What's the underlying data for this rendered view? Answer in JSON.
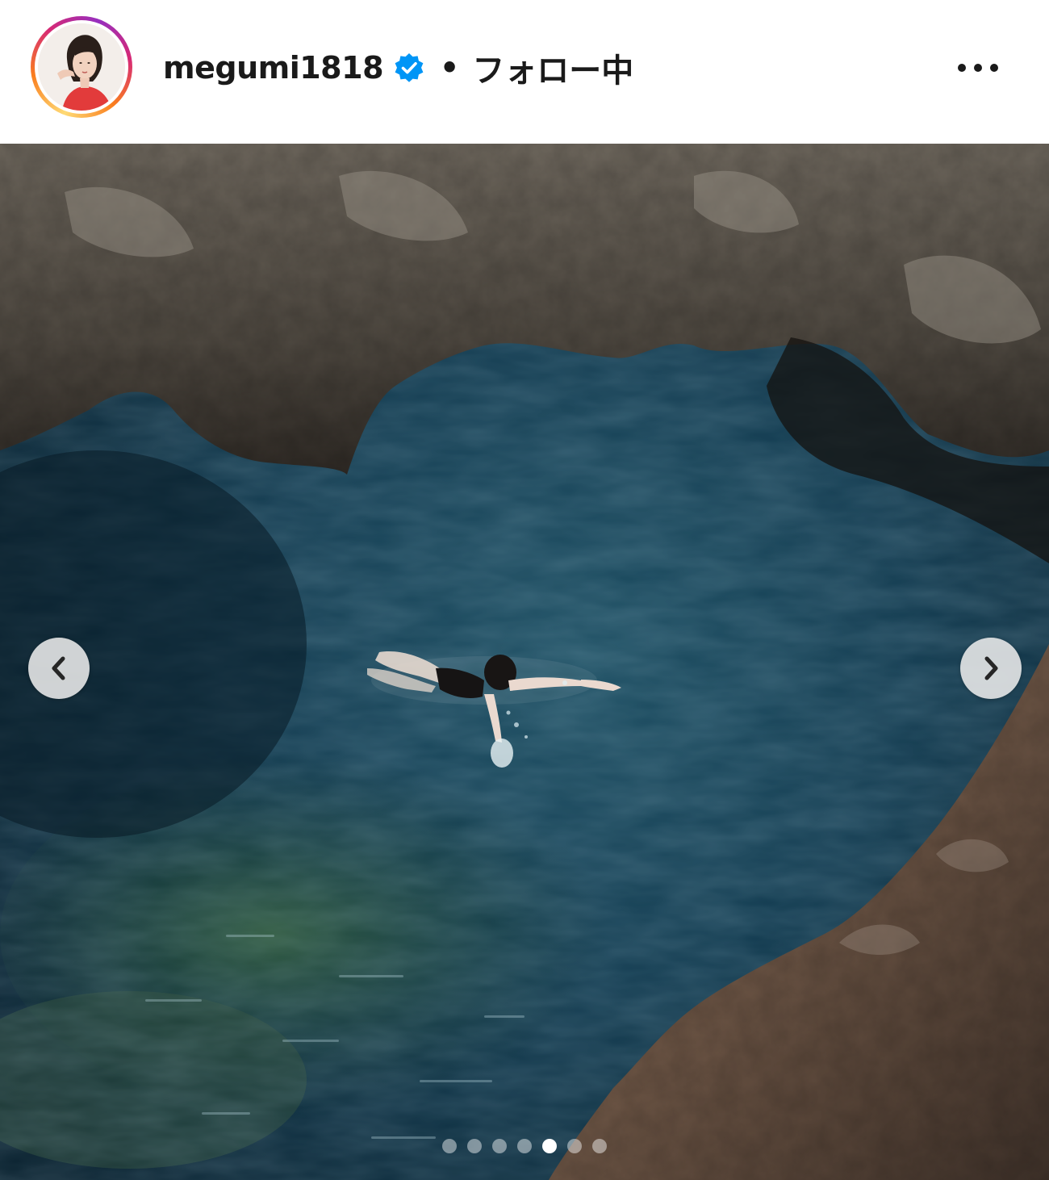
{
  "post": {
    "username": "megumi1818",
    "verified": true,
    "separator": "•",
    "follow_status": "フォロー中",
    "more_icon": "more-options-icon"
  },
  "carousel": {
    "total_slides": 7,
    "active_index": 4,
    "prev_icon": "chevron-left-icon",
    "next_icon": "chevron-right-icon"
  },
  "colors": {
    "verified_badge": "#0095f6",
    "text": "#1a1a1a",
    "water": "#0f3548",
    "rock": "#5d564c"
  }
}
